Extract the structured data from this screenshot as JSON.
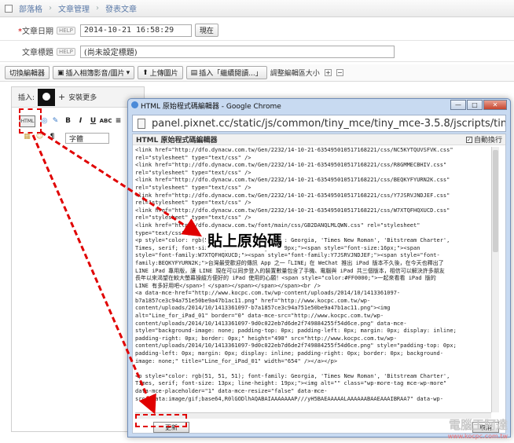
{
  "breadcrumb": [
    "部落格",
    "文章管理",
    "發表文章"
  ],
  "form": {
    "date_label": "文章日期",
    "date_value": "2014-10-21 16:58:29",
    "now_button": "現在",
    "title_label": "文章標題",
    "title_value": "(尚未設定標題)",
    "help": "HELP"
  },
  "toolbar": {
    "switch_editor": "切換編輯器",
    "insert_album": "插入相簿影音/圖片",
    "upload_image": "上傳圖片",
    "insert_more": "插入「繼續閱讀...」",
    "resize_label": "調整編輯區大小"
  },
  "editor": {
    "insert_label": "插入:",
    "install_more": "安裝更多",
    "font_select": "字體",
    "html_icon": "HTML"
  },
  "popup": {
    "window_title": "HTML 原始程式碼編輯器 - Google Chrome",
    "url": "panel.pixnet.cc/static/js/common/tiny_mce/tiny_mce-3.5.8/jscripts/tiny_mce/themes/advan",
    "header_title": "HTML 原始程式碼編輯器",
    "word_wrap": "自動換行",
    "update_button": "更新",
    "cancel_button": "取消",
    "code_lines": [
      "<link href=\"http://dfo.dynacw.com.tw/Gen/2232/14-10-21-635495010517168221/css/NC5KYTQUVSFVK.css\"",
      "rel=\"stylesheet\" type=\"text/css\" />",
      "<link href=\"http://dfo.dynacw.com.tw/Gen/2232/14-10-21-635495010517168221/css/R8GMMECBHIV.css\"",
      "rel=\"stylesheet\" type=\"text/css\" />",
      "<link href=\"http://dfo.dynacw.com.tw/Gen/2232/14-10-21-635495010517168221/css/BEQKYFYURN2K.css\"",
      "rel=\"stylesheet\" type=\"text/css\" />",
      "<link href=\"http://dfo.dynacw.com.tw/Gen/2232/14-10-21-635495010517168221/css/Y7JSRVJNDJEF.css\"",
      "rel=\"stylesheet\" type=\"text/css\" />",
      "<link href=\"http://dfo.dynacw.com.tw/Gen/2232/14-10-21-635495010517168221/css/W7XTQFHQXUCD.css\"",
      "rel=\"stylesheet\" type=\"text/css\" />",
      "<link href=\"http://dfo.dynacw.com.tw/font/main/css/GB2DANQLMLQWN.css\" rel=\"stylesheet\"",
      "type=\"text/css\" />",
      "<p style=\"color: rgb(51, 51, 51); font-family: Georgia, 'Times New Roman', 'Bitstream Charter',",
      "Times, serif; font-size: 13px; line-height: 19px;\"><span style=\"font-size:16px;\"><span",
      "style=\"font-family:W7XTQFHQXUCD;\"><span style=\"font-family:Y7JSRVJNDJEF;\"><span style=\"font-",
      "family:BEQKYFYURN2K;\">台灣最受歡迎的傳訊 App 之一「LINE」在 WeChat 推出 iPad 版本不久後，在今天也釋出了",
      "LINE iPad 專用版，讓 LINE 現在可以同步登入的裝置數量包含了手機、電腦與 iPad 共三個版本，相信可以解決許多朋友",
      "長年以來渴望在較大螢幕操縱方便好的 iPad 使用的心願！<span style=\"color:#FF0000;\">一起來看看 iPad 版的",
      "LINE 有多好用吧</span>！</span></span></span></span><br />",
      "<a data-mce-href=\"http://www.kocpc.com.tw/wp-content/uploads/2014/10/1413361097-",
      "b7a1857ce3c94a751e50be9a47b1ac11.png\" href=\"http://www.kocpc.com.tw/wp-",
      "content/uploads/2014/10/1413361097-b7a1857ce3c94a751e50be9a47b1ac11.png\"><img",
      "alt=\"Line_for_iPad_01\" border=\"0\" data-mce-src=\"http://www.kocpc.com.tw/wp-",
      "content/uploads/2014/10/1413361097-9d0c022eb7d6de2f749884255f54d6ce.png\" data-mce-",
      "style=\"background-image: none; padding-top: 0px; padding-left: 0px; margin: 0px; display: inline;",
      "padding-right: 0px; border: 0px;\" height=\"490\" src=\"http://www.kocpc.com.tw/wp-",
      "content/uploads/2014/10/1413361097-9d0c022eb7d6de2f749884255f54d6ce.png\" style=\"padding-top: 0px;",
      "padding-left: 0px; margin: 0px; display: inline; padding-right: 0px; border: 0px; background-",
      "image: none;\" title=\"Line_for_iPad_01\" width=\"654\" /></a></p>",
      "",
      "<p style=\"color: rgb(51, 51, 51); font-family: Georgia, 'Times New Roman', 'Bitstream Charter',",
      "Times, serif; font-size: 13px; line-height: 19px;\"><img alt=\"\" class=\"wp-more-tag mce-wp-more\"",
      "data-mce-placeholder=\"1\" data-mce-resize=\"false\" data-mce-",
      "src=\"data:image/gif;base64,R0lGODlhAQABAIAAAAAAAP///yH5BAEAAAAALAAAAAABAAEAAAIBRAA7\" data-wp-"
    ]
  },
  "annotation": {
    "paste_text": "貼上原始碼"
  },
  "watermark": {
    "title": "電腦王阿達",
    "url": "www.kocpc.com.tw"
  }
}
